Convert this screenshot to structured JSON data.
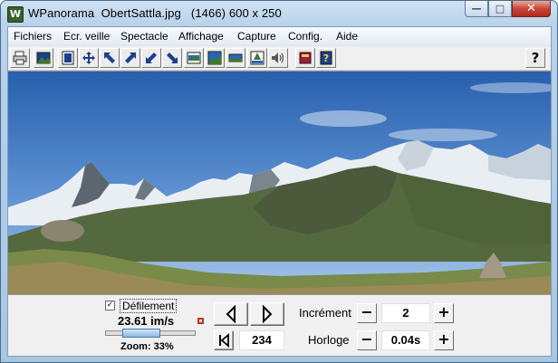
{
  "window": {
    "title": "WPanorama  ObertSattla.jpg   (1466) 600 x 250",
    "app_icon_letter": "W",
    "minimize_glyph": "—",
    "maximize_glyph": "□",
    "close_glyph": "✕"
  },
  "menu": [
    "Fichiers",
    "Ecr. veille",
    "Spectacle",
    "Affichage",
    "Capture",
    "Config.",
    "Aide"
  ],
  "toolbar": {
    "icons": [
      "print-icon",
      "picture-icon",
      "fit-frame-icon",
      "move-all-icon",
      "arrow-upleft-icon",
      "arrow-upright-icon",
      "arrow-downleft-icon",
      "arrow-downright-icon",
      "panorama-strip-icon",
      "panorama-fill-icon",
      "panorama-wide-icon",
      "panorama-top-icon",
      "sound-icon",
      "book-icon",
      "help-book-icon"
    ],
    "help_label": "?"
  },
  "controls": {
    "scroll_checked": true,
    "scroll_check_glyph": "✓",
    "scroll_label": "Défilement",
    "speed": "23.61 im/s",
    "zoom_label": "Zoom: 33%",
    "zoom_fraction": 0.33,
    "frame_value": "234",
    "increment_label": "Incrément",
    "increment_value": "2",
    "clock_label": "Horloge",
    "clock_value": "0.04s",
    "minus": "−",
    "plus": "+"
  },
  "colors": {
    "sky_top": "#2a66b8",
    "sky_bottom": "#8fb6e0",
    "snow": "#f4f6f8",
    "rock": "#5b6a72",
    "grass": "#6e8a3a",
    "ground": "#8a7a52",
    "close_button": "#c7483a"
  }
}
